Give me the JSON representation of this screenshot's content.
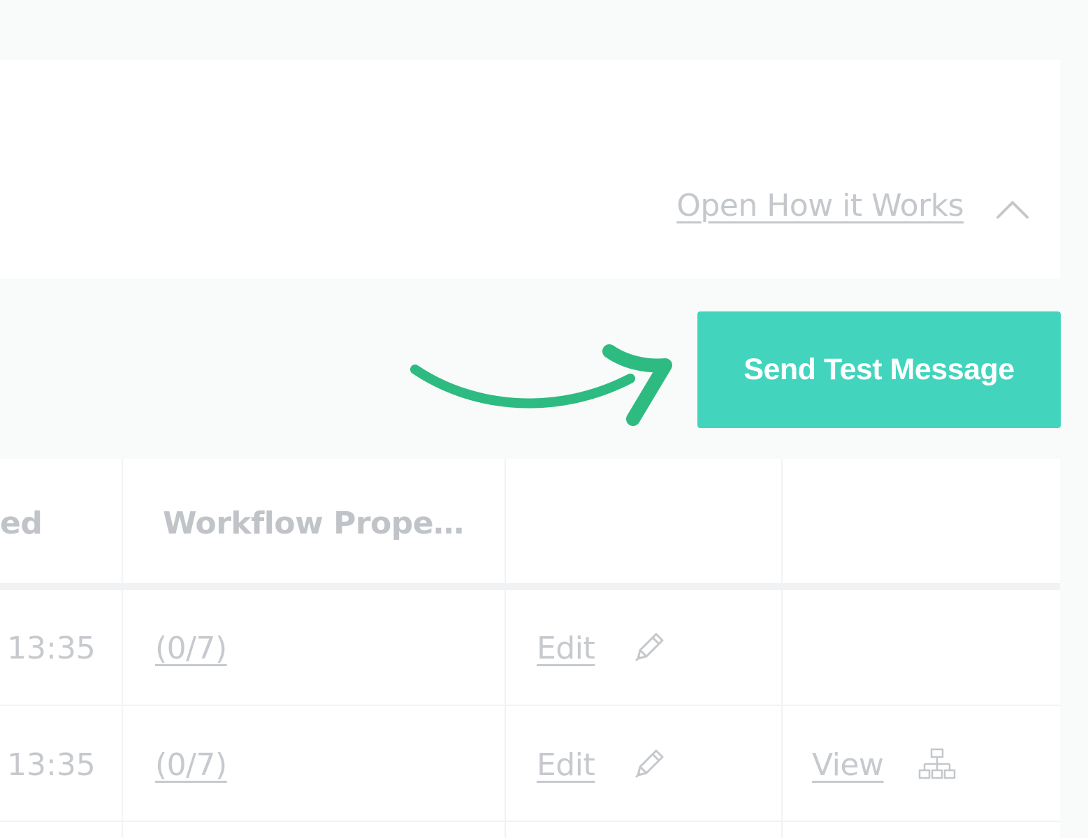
{
  "how_it_works": {
    "link_label": "Open How it Works",
    "toggle_icon": "chevron-up-icon"
  },
  "actions": {
    "send_test_label": "Send Test Message",
    "pointer_icon": "curved-arrow-icon",
    "accent_color": "#43d4bd",
    "arrow_color": "#2dbb82"
  },
  "table": {
    "columns": [
      "ed",
      "Workflow Prope…",
      "",
      ""
    ],
    "rows": [
      {
        "time": "13:35",
        "properties": "(0/7)",
        "edit_label": "Edit",
        "edit_icon": "pencil-icon",
        "view_label": "",
        "view_icon": ""
      },
      {
        "time": "13:35",
        "properties": "(0/7)",
        "edit_label": "Edit",
        "edit_icon": "pencil-icon",
        "view_label": "View",
        "view_icon": "sitemap-icon"
      }
    ]
  }
}
